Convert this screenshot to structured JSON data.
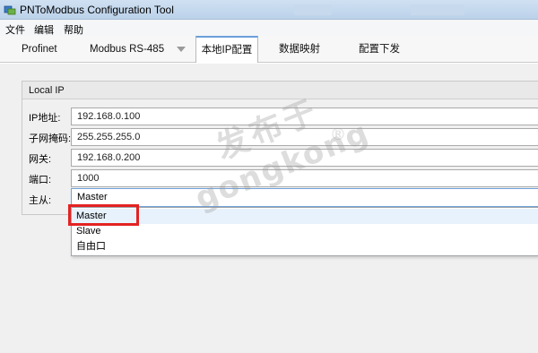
{
  "window": {
    "title": "PNToModbus Configuration Tool"
  },
  "menu": {
    "items": [
      "文件",
      "编辑",
      "帮助"
    ]
  },
  "tabs": {
    "items": [
      "Profinet",
      "Modbus RS-485",
      "本地IP配置",
      "数据映射",
      "配置下发"
    ],
    "active_index": 2
  },
  "local_ip": {
    "group_title": "Local IP",
    "fields": [
      {
        "label": "IP地址:",
        "value": "192.168.0.100"
      },
      {
        "label": "子网掩码:",
        "value": "255.255.255.0"
      },
      {
        "label": "网关:",
        "value": "192.168.0.200"
      },
      {
        "label": "端口:",
        "value": "1000"
      }
    ],
    "role": {
      "label": "主从:",
      "value": "Master",
      "options": [
        "Master",
        "Slave",
        "自由口"
      ]
    }
  },
  "watermark": {
    "brand_cn": "发布于",
    "brand_en": "gongkong",
    "registered": "®"
  },
  "colors": {
    "accent": "#6fa3d9",
    "highlight": "#e32222",
    "titlebar": "#c4d8ee"
  }
}
